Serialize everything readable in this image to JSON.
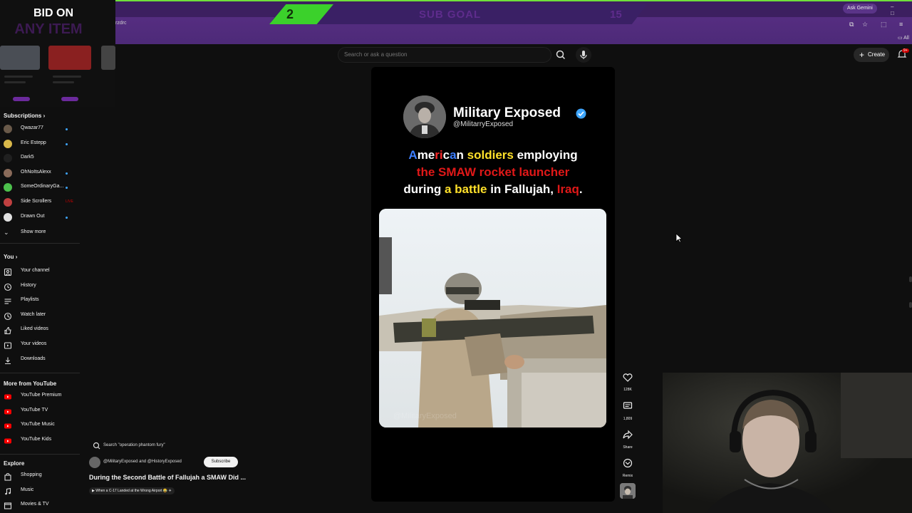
{
  "browser": {
    "url_fragment": "rzdrc",
    "ask_gemini": "Ask Gemini",
    "window_controls": "– □"
  },
  "overlay": {
    "subgoal_count": "2",
    "subgoal_label": "SUB GOAL",
    "subgoal_target": "15",
    "bid_line1": "BID ON",
    "bid_line2": "ANY ITEM"
  },
  "header": {
    "search_placeholder": "Search or ask a question",
    "create_label": "Create",
    "notification_badge": "9+"
  },
  "sidebar": {
    "subscriptions_heading": "Subscriptions",
    "subscriptions": [
      {
        "label": "Qwazar77",
        "avatar_color": "#6a5a4a",
        "indicator": "dot"
      },
      {
        "label": "Eric Estepp",
        "avatar_color": "#d9b84a",
        "indicator": "dot"
      },
      {
        "label": "Dark5",
        "avatar_color": "#202020",
        "indicator": "none"
      },
      {
        "label": "OhNoItsAlexx",
        "avatar_color": "#8a6b5a",
        "indicator": "dot"
      },
      {
        "label": "SomeOrdinaryGa...",
        "avatar_color": "#4cc04c",
        "indicator": "dot"
      },
      {
        "label": "Side Scrollers",
        "avatar_color": "#c04040",
        "indicator": "live"
      },
      {
        "label": "Drawn Out",
        "avatar_color": "#e0e0e0",
        "indicator": "dot"
      }
    ],
    "show_more": "Show more",
    "you_heading": "You",
    "you_items": [
      {
        "label": "Your channel",
        "icon": "channel-icon"
      },
      {
        "label": "History",
        "icon": "history-icon"
      },
      {
        "label": "Playlists",
        "icon": "playlists-icon"
      },
      {
        "label": "Watch later",
        "icon": "watch-later-icon"
      },
      {
        "label": "Liked videos",
        "icon": "like-icon"
      },
      {
        "label": "Your videos",
        "icon": "your-videos-icon"
      },
      {
        "label": "Downloads",
        "icon": "download-icon"
      }
    ],
    "more_heading": "More from YouTube",
    "more_items": [
      {
        "label": "YouTube Premium",
        "color": "#ff0000"
      },
      {
        "label": "YouTube TV",
        "color": "#ff0000"
      },
      {
        "label": "YouTube Music",
        "color": "#ff0000"
      },
      {
        "label": "YouTube Kids",
        "color": "#ff0000"
      }
    ],
    "explore_heading": "Explore",
    "explore_items": [
      {
        "label": "Shopping",
        "icon": "shopping-icon"
      },
      {
        "label": "Music",
        "icon": "music-icon"
      },
      {
        "label": "Movies & TV",
        "icon": "movies-icon"
      }
    ],
    "live_label": "LIVE"
  },
  "short": {
    "channel_name": "Military Exposed",
    "channel_handle": "@MilitarryExposed",
    "caption": [
      [
        {
          "t": "A",
          "c": "#3d7eff"
        },
        {
          "t": "me",
          "c": "#ffffff"
        },
        {
          "t": "ri",
          "c": "#ff2a2a"
        },
        {
          "t": "c",
          "c": "#ffffff"
        },
        {
          "t": "a",
          "c": "#3d7eff"
        },
        {
          "t": "n ",
          "c": "#ffffff"
        },
        {
          "t": "soldiers",
          "c": "#ffe02a"
        },
        {
          "t": " employing",
          "c": "#ffffff"
        }
      ],
      [
        {
          "t": "the SMAW rocket launcher",
          "c": "#e01818"
        }
      ],
      [
        {
          "t": "during ",
          "c": "#ffffff"
        },
        {
          "t": "a battle",
          "c": "#ffe02a"
        },
        {
          "t": " in Fallujah, ",
          "c": "#ffffff"
        },
        {
          "t": "Iraq",
          "c": "#e01818"
        },
        {
          "t": ".",
          "c": "#ffffff"
        }
      ]
    ],
    "watermark": "@MilitaryExposed",
    "likes": "128K",
    "comments": "1,809",
    "share_label": "Share",
    "remix_label": "Remix"
  },
  "next_video": {
    "search_suggestion": "Search \"operation phantom fury\"",
    "channels": "@MilitaryExposed and @HistoryExposed",
    "subscribe_label": "Subscribe",
    "title": "During the Second Battle of Fallujah a SMAW Did ...",
    "related": "▶ When a C-17 Landed at the Wrong Airport 😂 ✈"
  },
  "colors": {
    "subgoal_green": "#3bd12b",
    "chrome_purple": "#4d2a78",
    "verified_blue": "#3ea6ff"
  }
}
